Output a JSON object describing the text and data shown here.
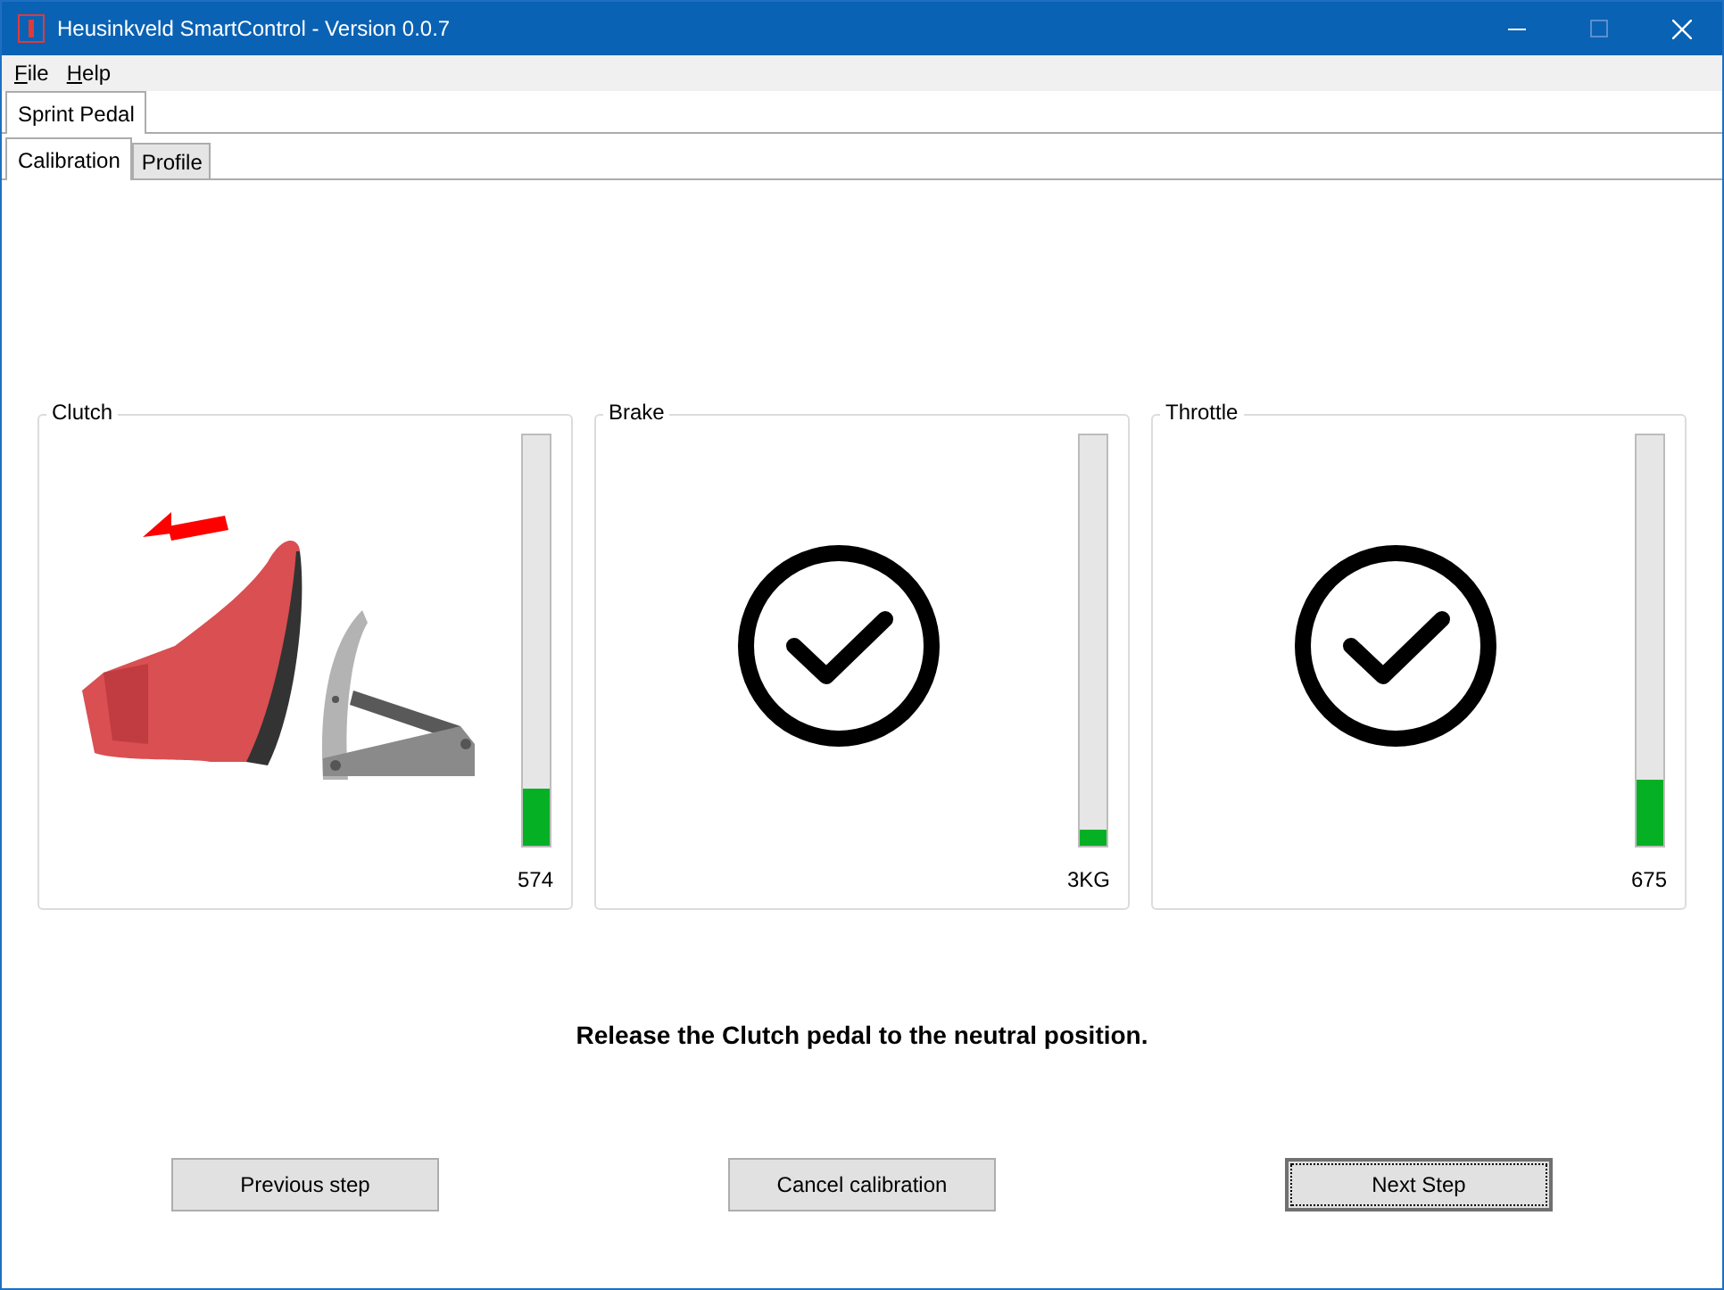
{
  "window": {
    "title": "Heusinkveld SmartControl - Version 0.0.7"
  },
  "menu": [
    {
      "label": "File"
    },
    {
      "label": "Help"
    }
  ],
  "device_tabs": [
    {
      "label": "Sprint Pedal",
      "selected": true
    }
  ],
  "tabs": [
    {
      "label": "Calibration",
      "selected": true
    },
    {
      "label": "Profile",
      "selected": false
    }
  ],
  "pedals": [
    {
      "name": "Clutch",
      "kind": "pedal",
      "level": 0.14,
      "reading": "574"
    },
    {
      "name": "Brake",
      "kind": "check",
      "level": 0.04,
      "reading": "3KG"
    },
    {
      "name": "Throttle",
      "kind": "check",
      "level": 0.16,
      "reading": "675"
    }
  ],
  "message": "Release the Clutch pedal to the neutral position.",
  "buttons": [
    {
      "label": "Previous step",
      "focused": false
    },
    {
      "label": "Cancel calibration",
      "focused": false
    },
    {
      "label": "Next Step",
      "focused": true
    }
  ]
}
